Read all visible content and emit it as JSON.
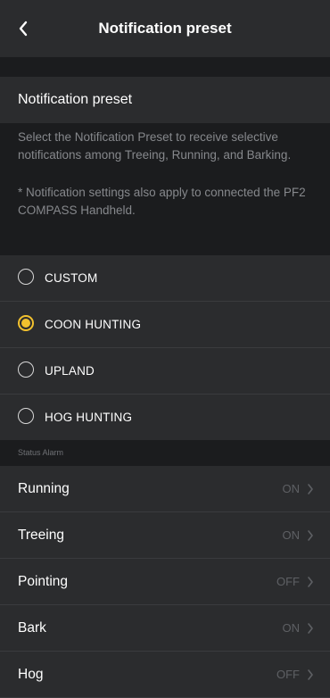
{
  "header": {
    "title": "Notification preset",
    "back_icon": "chevron-left-icon"
  },
  "section": {
    "title": "Notification preset",
    "description": "Select the Notification Preset to receive selective notifications among Treeing, Running, and Barking.",
    "note": "* Notification settings also apply to connected the PF2 COMPASS Handheld."
  },
  "presets": [
    {
      "label": "CUSTOM",
      "selected": false
    },
    {
      "label": "COON HUNTING",
      "selected": true
    },
    {
      "label": "UPLAND",
      "selected": false
    },
    {
      "label": "HOG HUNTING",
      "selected": false
    }
  ],
  "status_alarm": {
    "header": "Status Alarm",
    "items": [
      {
        "label": "Running",
        "value": "ON"
      },
      {
        "label": "Treeing",
        "value": "ON"
      },
      {
        "label": "Pointing",
        "value": "OFF"
      },
      {
        "label": "Bark",
        "value": "ON"
      },
      {
        "label": "Hog",
        "value": "OFF"
      }
    ]
  },
  "colors": {
    "accent": "#f2c12e",
    "panel": "#2b2c2e",
    "background": "#1b1c1e"
  }
}
